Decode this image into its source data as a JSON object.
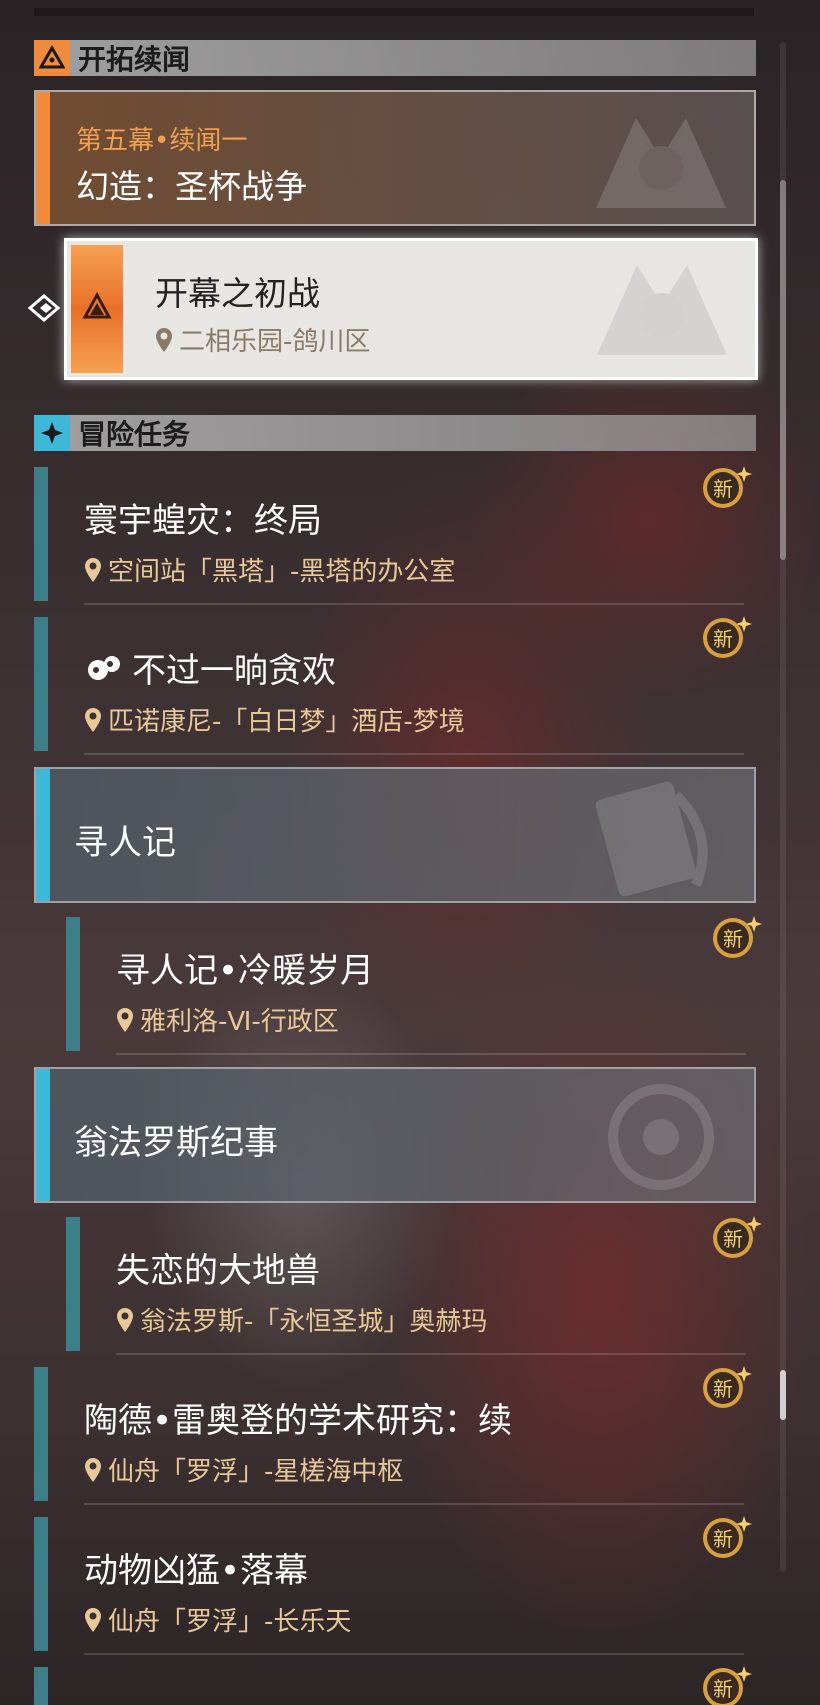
{
  "sections": {
    "trailblaze": {
      "label": "开拓续闻"
    },
    "adventure": {
      "label": "冒险任务"
    }
  },
  "main_quest": {
    "chapter": "第五幕•续闻一",
    "title": "幻造：圣杯战争"
  },
  "selected_quest": {
    "title": "开幕之初战",
    "location": "二相乐园-鸽川区"
  },
  "quests": [
    {
      "title": "寰宇蝗灾：终局",
      "location": "空间站「黑塔」-黑塔的办公室",
      "badge": "新"
    },
    {
      "title": "不过一晌贪欢",
      "location": "匹诺康尼-「白日梦」酒店-梦境",
      "badge": "新"
    },
    {
      "title": "陶德•雷奥登的学术研究：续",
      "location": "仙舟「罗浮」-星槎海中枢",
      "badge": "新"
    },
    {
      "title": "动物凶猛•落幕",
      "location": "仙舟「罗浮」-长乐天",
      "badge": "新"
    }
  ],
  "groups": [
    {
      "title": "寻人记",
      "sub": {
        "title": "寻人记•冷暖岁月",
        "location": "雅利洛-Ⅵ-行政区",
        "badge": "新"
      }
    },
    {
      "title": "翁法罗斯纪事",
      "sub": {
        "title": "失恋的大地兽",
        "location": "翁法罗斯-「永恒圣城」奥赫玛",
        "badge": "新"
      }
    }
  ],
  "partial_badge": "新",
  "colors": {
    "trailblaze_accent": "#f08a3c",
    "adventure_accent": "#3d7f88",
    "group_accent": "#3fb7d8",
    "location_text": "#e8c898"
  }
}
